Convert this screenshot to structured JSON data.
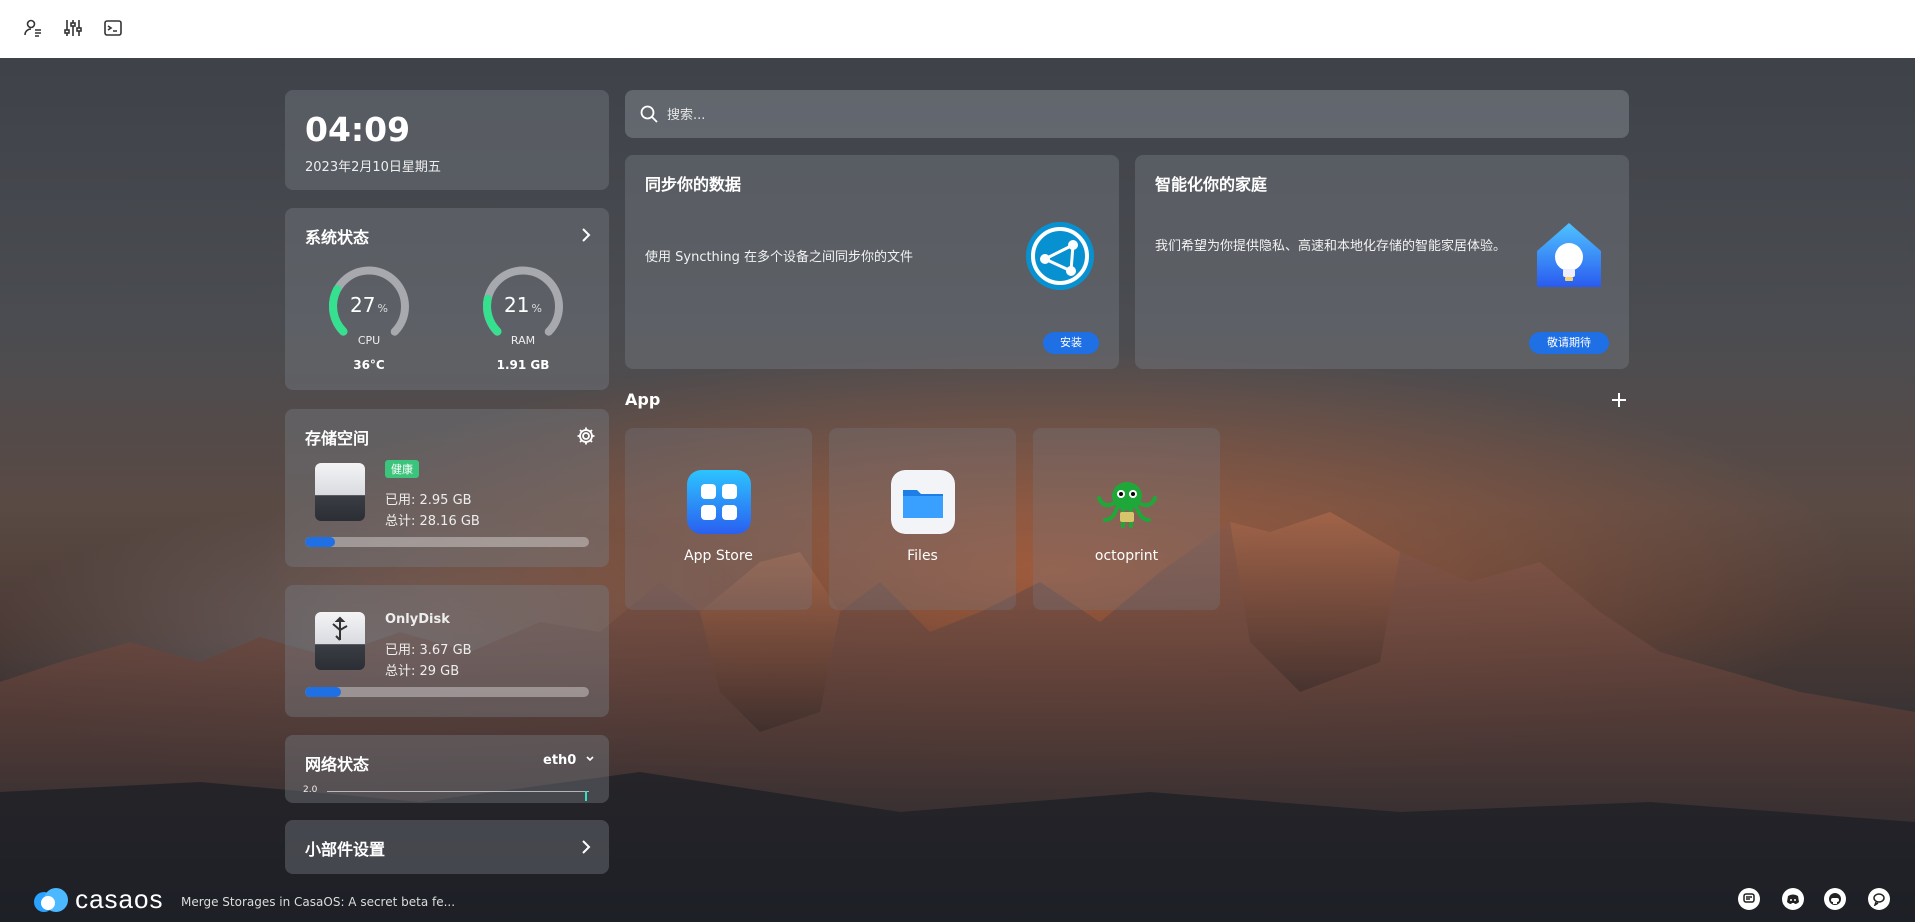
{
  "topbar": {
    "icons": [
      "user-list-icon",
      "sliders-icon",
      "terminal-icon"
    ]
  },
  "clock": {
    "time": "04:09",
    "date": "2023年2月10日星期五"
  },
  "system_status": {
    "title": "系统状态",
    "cpu": {
      "value": "27",
      "unit": "%",
      "label": "CPU",
      "sub": "36°C",
      "percent": 27
    },
    "ram": {
      "value": "21",
      "unit": "%",
      "label": "RAM",
      "sub": "1.91 GB",
      "percent": 21
    }
  },
  "storage": {
    "title": "存储空间",
    "badge": "健康",
    "used": "已用: 2.95 GB",
    "total": "总计: 28.16 GB",
    "used_fraction": 0.105
  },
  "onlydisk": {
    "name": "OnlyDisk",
    "used": "已用: 3.67 GB",
    "total": "总计: 29 GB",
    "used_fraction": 0.127
  },
  "network": {
    "title": "网络状态",
    "interface": "eth0",
    "axis_label": "2.0"
  },
  "widget_settings": {
    "title": "小部件设置"
  },
  "search": {
    "placeholder": "搜索..."
  },
  "promos": [
    {
      "title": "同步你的数据",
      "description": "使用 Syncthing 在多个设备之间同步你的文件",
      "button": "安装"
    },
    {
      "title": "智能化你的家庭",
      "description": "我们希望为你提供隐私、高速和本地化存储的智能家居体验。",
      "button": "敬请期待"
    }
  ],
  "apps": {
    "title": "App",
    "items": [
      {
        "label": "App Store"
      },
      {
        "label": "Files"
      },
      {
        "label": "octoprint"
      }
    ]
  },
  "footer": {
    "logo_text": "casaos",
    "news": "Merge Storages in CasaOS: A secret beta fe...",
    "icons": [
      "message-icon",
      "discord-icon",
      "github-icon",
      "chat-icon"
    ]
  },
  "colors": {
    "accent": "#1f6fe5",
    "gauge": "#35e08f",
    "healthy": "#3cc47c"
  }
}
